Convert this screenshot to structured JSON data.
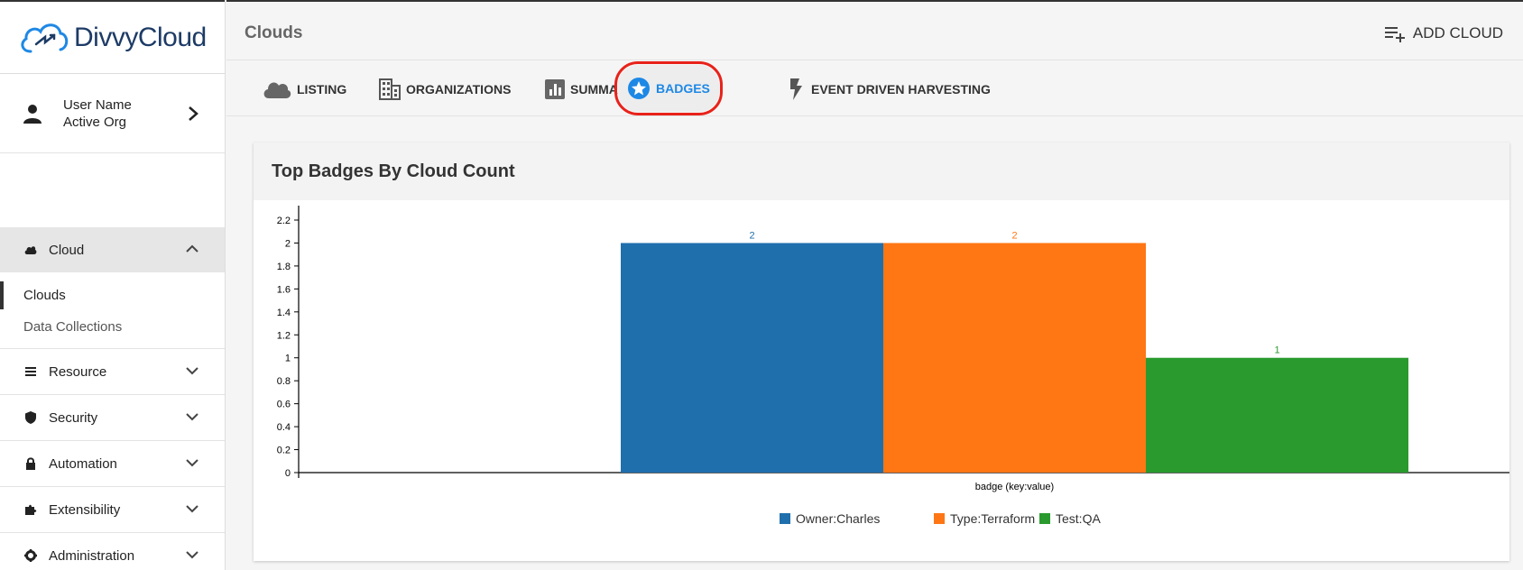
{
  "brand": {
    "name": "DivvyCloud"
  },
  "user": {
    "name": "User Name",
    "org": "Active Org"
  },
  "sidebar": {
    "sections": [
      {
        "label": "Cloud",
        "icon": "cloud-icon",
        "expanded": true,
        "items": [
          {
            "label": "Clouds"
          },
          {
            "label": "Data Collections"
          }
        ]
      },
      {
        "label": "Resource",
        "icon": "list-icon"
      },
      {
        "label": "Security",
        "icon": "shield-icon"
      },
      {
        "label": "Automation",
        "icon": "lock-icon"
      },
      {
        "label": "Extensibility",
        "icon": "puzzle-icon"
      },
      {
        "label": "Administration",
        "icon": "gear-icon"
      }
    ]
  },
  "header": {
    "title": "Clouds",
    "add_cloud_label": "ADD CLOUD"
  },
  "tabs": [
    {
      "label": "LISTING",
      "icon": "cloud-icon"
    },
    {
      "label": "ORGANIZATIONS",
      "icon": "building-icon"
    },
    {
      "label": "SUMMARY",
      "icon": "bar-chart-icon"
    },
    {
      "label": "BADGES",
      "icon": "star-badge-icon",
      "active": true
    },
    {
      "label": "EVENT DRIVEN HARVESTING",
      "icon": "lightning-icon"
    }
  ],
  "card": {
    "title": "Top Badges By Cloud Count"
  },
  "chart_data": {
    "type": "bar",
    "categories": [
      "badge (key:value)"
    ],
    "series": [
      {
        "name": "Owner:Charles",
        "values": [
          2
        ],
        "color": "#1f6fad"
      },
      {
        "name": "Type:Terraform",
        "values": [
          2
        ],
        "color": "#ff7615"
      },
      {
        "name": "Test:QA",
        "values": [
          1
        ],
        "color": "#2a9a2e"
      }
    ],
    "xlabel": "badge (key:value)",
    "ylabel": "",
    "ylim": [
      0,
      2.2
    ],
    "yticks": [
      "0",
      "0.2",
      "0.4",
      "0.6",
      "0.8",
      "1",
      "1.2",
      "1.4",
      "1.6",
      "1.8",
      "2",
      "2.2"
    ],
    "legend": "bottom",
    "grid": false
  }
}
